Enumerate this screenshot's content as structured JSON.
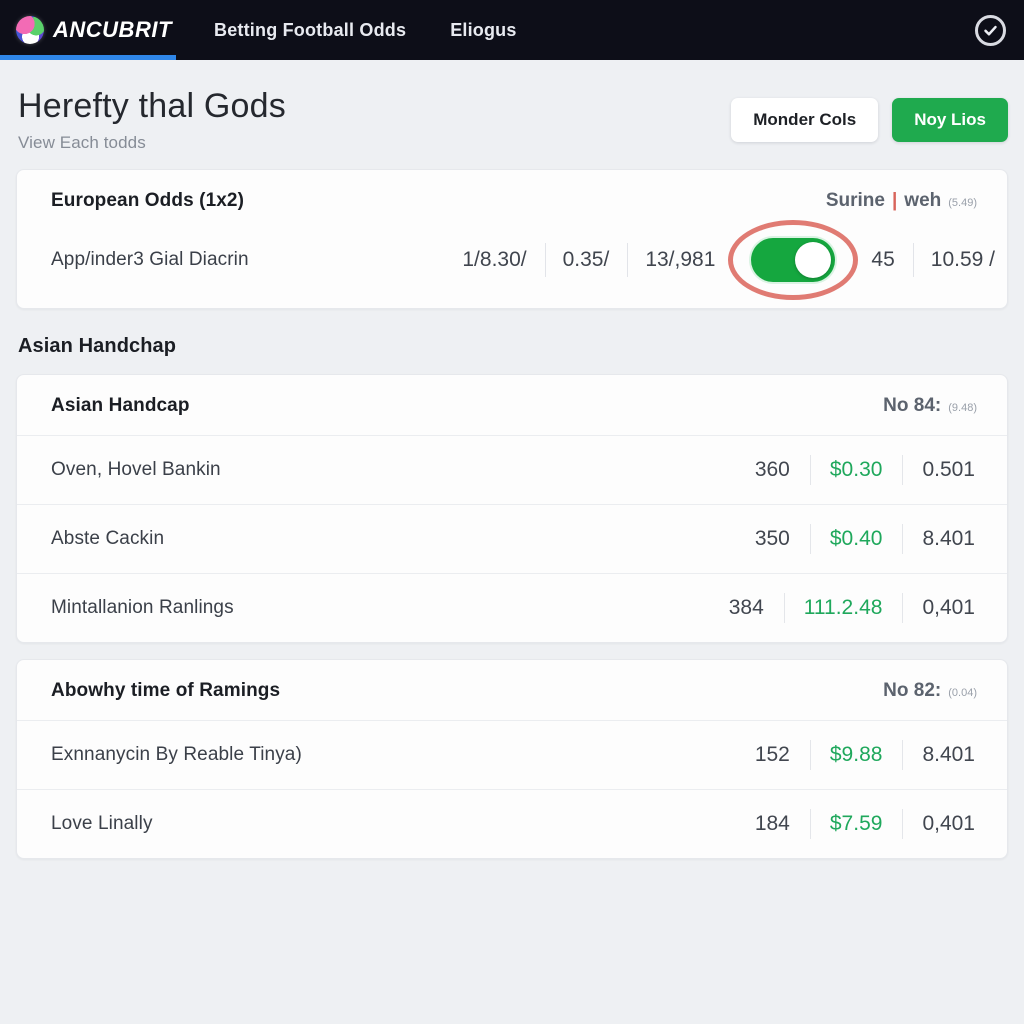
{
  "navbar": {
    "brand": "ANCUBRIT",
    "links": [
      "Betting Football Odds",
      "Eliogus"
    ],
    "status_icon": "check-circle-icon"
  },
  "header": {
    "title": "Herefty thal Gods",
    "subtitle": "View Each todds",
    "secondary_button": "Monder Cols",
    "primary_button": "Noy Lios"
  },
  "european_card": {
    "title": "European Odds (1x2)",
    "meta_left": "Surine",
    "meta_sep": "|",
    "meta_right": "weh",
    "meta_small": "(5.49)",
    "row": {
      "label": "App/inder3 Gial Diacrin",
      "cell1": "1/8.30/",
      "cell2": "0.35/",
      "cell3": "13/,981",
      "toggle_on": true,
      "cell4": "45",
      "cell5": "10.59 /"
    }
  },
  "section": {
    "title": "Asian Handchap"
  },
  "handicap_card": {
    "title": "Asian Handcap",
    "meta_strong": "No 84:",
    "meta_small": "(9.48)",
    "rows": [
      {
        "name": "Oven, Hovel Bankin",
        "count": "360",
        "money": "$0.30",
        "value": "0.501"
      },
      {
        "name": "Abste Cackin",
        "count": "350",
        "money": "$0.40",
        "value": "8.401"
      },
      {
        "name": "Mintallanion Ranlings",
        "count": "384",
        "money": "111.2.48",
        "value": "0,401"
      }
    ]
  },
  "ramings_card": {
    "title": "Abowhy time of Ramings",
    "meta_strong": "No 82:",
    "meta_small": "(0.04)",
    "rows": [
      {
        "name": "Exnnanycin By Reable Tinya)",
        "count": "152",
        "money": "$9.88",
        "value": "8.401"
      },
      {
        "name": "Love Linally",
        "count": "184",
        "money": "$7.59",
        "value": "0,401"
      }
    ]
  },
  "colors": {
    "nav_bg": "#0d0e18",
    "accent_blue": "#2f86e8",
    "primary_green": "#1faa4e",
    "money_green": "#1fa85c",
    "annotation_red": "#e07b73",
    "page_bg": "#eef0f3"
  }
}
